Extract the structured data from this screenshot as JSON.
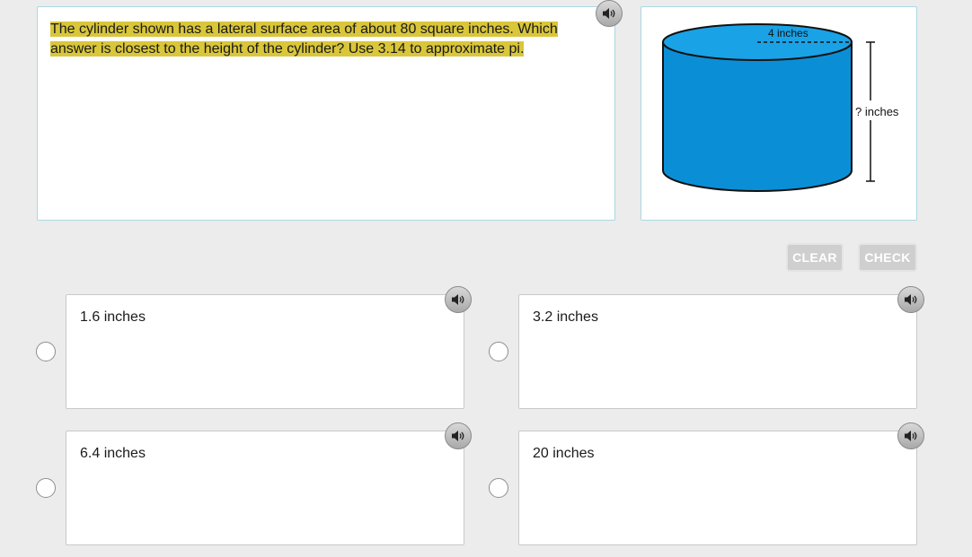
{
  "question": {
    "text": "The cylinder shown has a lateral surface area of about 80 square inches. Which answer is closest to the height of the cylinder? Use 3.14 to approximate pi."
  },
  "figure": {
    "radius_label": "4 inches",
    "height_label": "? inches",
    "cylinder_color": "#0a8fd6"
  },
  "buttons": {
    "clear_label": "CLEAR",
    "check_label": "CHECK"
  },
  "choices": [
    {
      "label": "1.6 inches"
    },
    {
      "label": "3.2 inches"
    },
    {
      "label": "6.4 inches"
    },
    {
      "label": "20 inches"
    }
  ],
  "icons": {
    "speaker": "speaker-icon",
    "radio": "radio-button"
  },
  "colors": {
    "highlight": "#d9c63a",
    "panel_border": "#a9d8e3",
    "background": "#ececec"
  }
}
